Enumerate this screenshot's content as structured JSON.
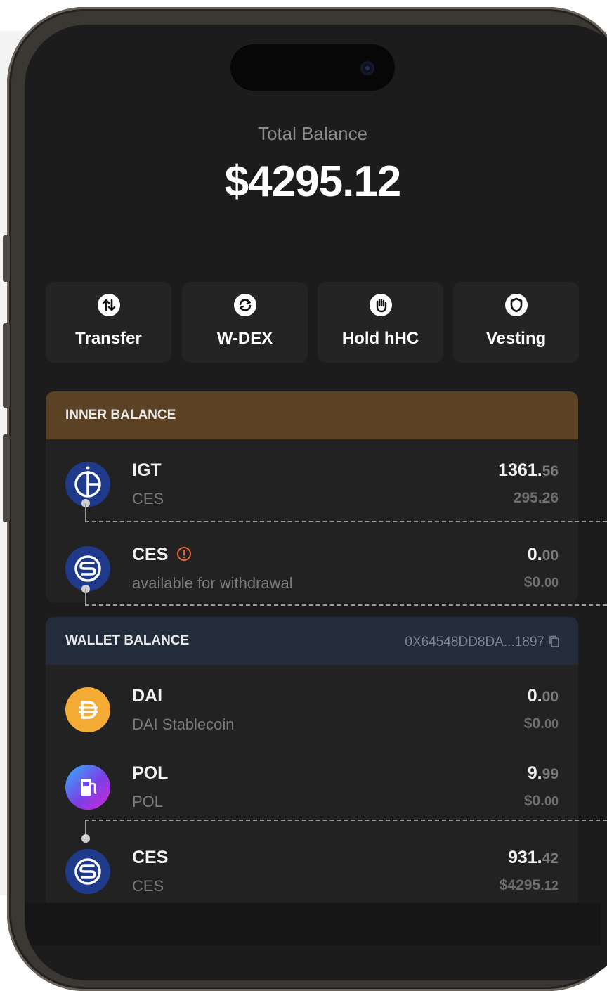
{
  "balance": {
    "label": "Total Balance",
    "amount": "$4295.12"
  },
  "actions": [
    {
      "label": "Transfer",
      "icon": "transfer-icon"
    },
    {
      "label": "W-DEX",
      "icon": "swap-icon"
    },
    {
      "label": "Hold hHC",
      "icon": "hand-icon"
    },
    {
      "label": "Vesting",
      "icon": "shield-icon"
    }
  ],
  "inner_balance": {
    "title": "INNER BALANCE",
    "assets": [
      {
        "name": "IGT",
        "sub": "CES",
        "amount_int": "1361.",
        "amount_dec": "56",
        "value_int": "295.26",
        "value_dec": "",
        "icon": "igt-coin-icon",
        "color": "#1f3a8a"
      },
      {
        "name": "CES",
        "sub": "available for withdrawal",
        "amount_int": "0.",
        "amount_dec": "00",
        "value_int": "$0.",
        "value_dec": "00",
        "icon": "ces-coin-icon",
        "color": "#1f3a8a",
        "warning": "warning-icon"
      }
    ]
  },
  "wallet_balance": {
    "title": "WALLET BALANCE",
    "address": "0X64548DD8DA...1897",
    "assets": [
      {
        "name": "DAI",
        "sub": "DAI Stablecoin",
        "amount_int": "0.",
        "amount_dec": "00",
        "value_int": "$0.",
        "value_dec": "00",
        "icon": "dai-coin-icon",
        "color": "#f5ac37"
      },
      {
        "name": "POL",
        "sub": "POL",
        "amount_int": "9.",
        "amount_dec": "99",
        "value_int": "$0.",
        "value_dec": "00",
        "icon": "pol-gas-icon",
        "color": "#7b3fe4"
      },
      {
        "name": "CES",
        "sub": "CES",
        "amount_int": "931.",
        "amount_dec": "42",
        "value_int": "$4295.",
        "value_dec": "12",
        "icon": "ces-coin-icon",
        "color": "#1f3a8a"
      }
    ]
  },
  "colors": {
    "screen_bg": "#1c1c1c",
    "inner_header": "#5b4224",
    "wallet_header": "#232c3a",
    "warning": "#e0653a"
  }
}
